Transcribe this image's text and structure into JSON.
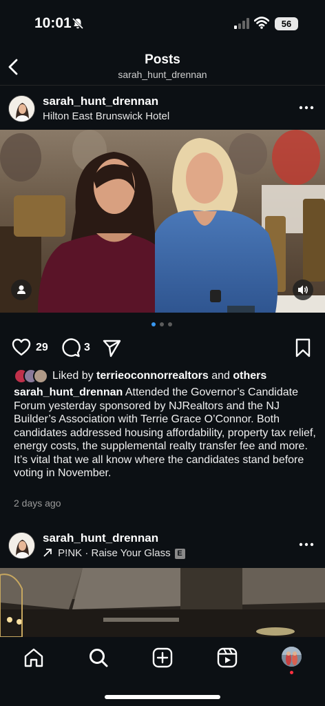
{
  "status_bar": {
    "time": "10:01",
    "battery": "56"
  },
  "header": {
    "title": "Posts",
    "subtitle": "sarah_hunt_drennan"
  },
  "post1": {
    "username": "sarah_hunt_drennan",
    "location": "Hilton East Brunswick Hotel",
    "likes": "29",
    "comments": "3",
    "liked_by_prefix": "Liked by ",
    "liked_by_user": "terrieoconnorrealtors",
    "liked_by_and": " and ",
    "liked_by_others": "others",
    "caption_user": "sarah_hunt_drennan",
    "caption_text": " Attended the Governor’s Candidate Forum yesterday sponsored by NJRealtors and the NJ Builder’s Association with Terrie Grace O’Connor. Both candidates addressed housing affordability, property tax relief, energy costs, the supplemental realty transfer fee and more. It’s vital that we all know where the candidates stand before voting in November.",
    "timestamp": "2 days ago",
    "carousel_active": 1,
    "carousel_count": 3
  },
  "post2": {
    "username": "sarah_hunt_drennan",
    "audio": "P!NK · Raise Your Glass",
    "explicit": "E"
  },
  "icons": {
    "back": "chevron-left-icon",
    "more": "more-horizontal-icon",
    "like": "heart-icon",
    "comment": "comment-icon",
    "share": "send-icon",
    "save": "bookmark-icon",
    "tabs": [
      "home-icon",
      "search-icon",
      "create-icon",
      "reels-icon",
      "profile-avatar"
    ]
  },
  "colors": {
    "background": "#0c1014",
    "active_dot": "#3897f0",
    "notification": "#ff3040"
  }
}
